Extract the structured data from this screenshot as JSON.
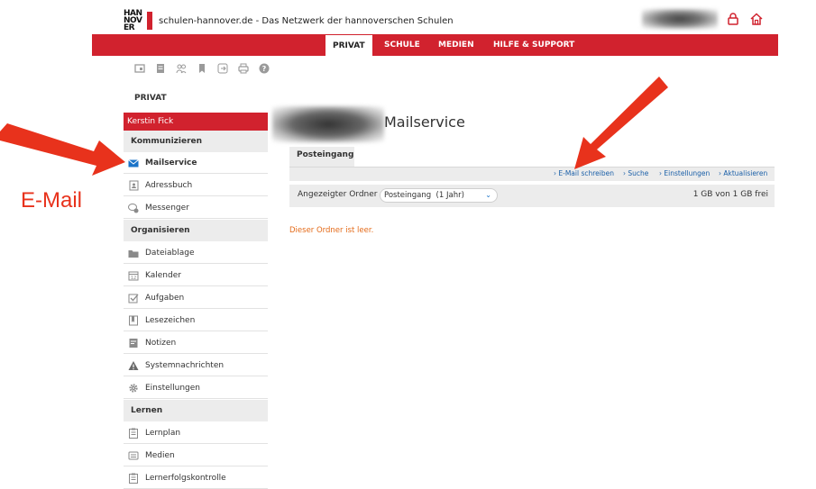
{
  "header": {
    "logo_text": "HAN NOV ER",
    "site_title": "schulen-hannover.de - Das Netzwerk der hannoverschen Schulen",
    "icons": [
      "lock-icon",
      "home-icon"
    ]
  },
  "nav": {
    "items": [
      {
        "label": "PRIVAT",
        "active": true
      },
      {
        "label": "SCHULE",
        "active": false
      },
      {
        "label": "MEDIEN",
        "active": false
      },
      {
        "label": "HILFE & SUPPORT",
        "active": false
      }
    ]
  },
  "toolbar": {
    "icons": [
      "window-icon",
      "note-icon",
      "people-icon",
      "bookmark-icon",
      "logout-icon",
      "print-icon",
      "help-icon"
    ]
  },
  "sidebar": {
    "title": "PRIVAT",
    "user": "Kerstin Fick",
    "sections": [
      {
        "heading": "Kommunizieren",
        "items": [
          {
            "label": "Mailservice",
            "icon": "mail-icon",
            "selected": true
          },
          {
            "label": "Adressbuch",
            "icon": "addressbook-icon"
          },
          {
            "label": "Messenger",
            "icon": "messenger-icon"
          }
        ]
      },
      {
        "heading": "Organisieren",
        "items": [
          {
            "label": "Dateiablage",
            "icon": "folder-icon"
          },
          {
            "label": "Kalender",
            "icon": "calendar-icon"
          },
          {
            "label": "Aufgaben",
            "icon": "checkbox-icon"
          },
          {
            "label": "Lesezeichen",
            "icon": "bookmark-icon"
          },
          {
            "label": "Notizen",
            "icon": "notes-icon"
          },
          {
            "label": "Systemnachrichten",
            "icon": "warning-icon"
          },
          {
            "label": "Einstellungen",
            "icon": "gear-icon"
          }
        ]
      },
      {
        "heading": "Lernen",
        "items": [
          {
            "label": "Lernplan",
            "icon": "clipboard-icon"
          },
          {
            "label": "Medien",
            "icon": "media-icon"
          },
          {
            "label": "Lernerfolgskontrolle",
            "icon": "clipboard-icon"
          }
        ]
      }
    ]
  },
  "main": {
    "title": "Mailservice",
    "tab": "Posteingang",
    "actions": [
      "E-Mail schreiben",
      "Suche",
      "Einstellungen",
      "Aktualisieren"
    ],
    "folder_label": "Angezeigter Ordner",
    "folder_value": "Posteingang  (1 Jahr)",
    "quota": "1 GB von 1 GB frei",
    "empty_message": "Dieser Ordner ist leer."
  },
  "annotation": {
    "label": "E-Mail",
    "color": "#e8321c"
  },
  "colors": {
    "brand_red": "#d1222e",
    "link_blue": "#1a5fa8",
    "empty_orange": "#e46b1a"
  }
}
